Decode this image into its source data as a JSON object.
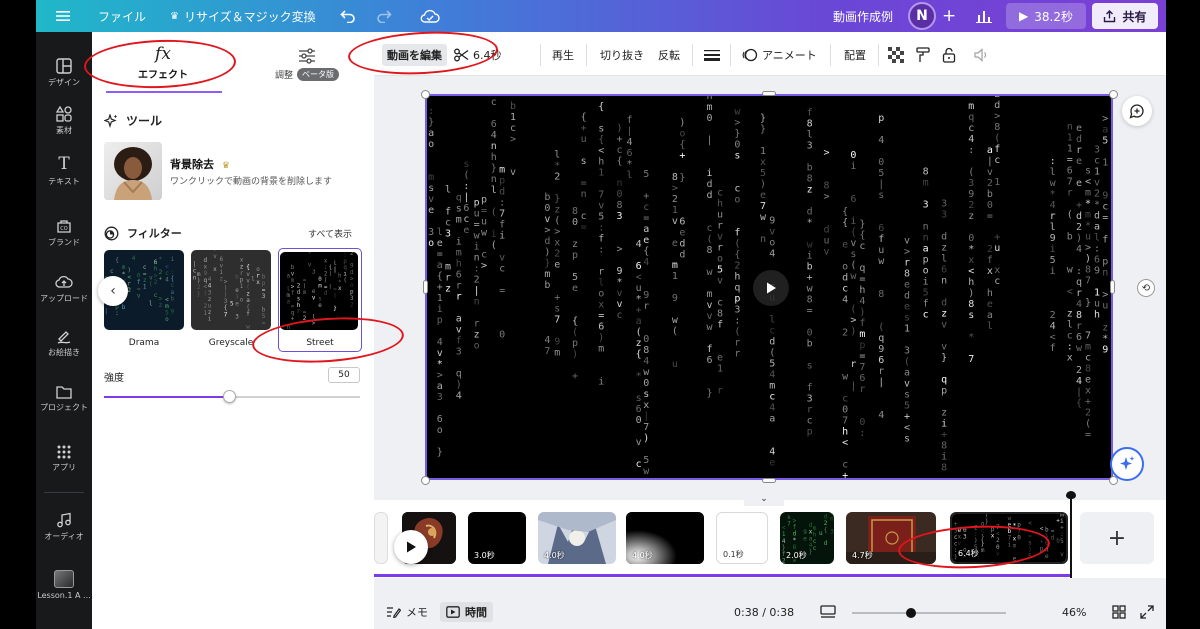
{
  "topbar": {
    "file": "ファイル",
    "resize": "リサイズ＆マジック変換",
    "project_title": "動画作成例",
    "avatar_initial": "N",
    "play_duration": "38.2秒",
    "share": "共有"
  },
  "rail": {
    "items": [
      {
        "label": "デザイン",
        "icon": "layout-icon"
      },
      {
        "label": "素材",
        "icon": "shapes-icon"
      },
      {
        "label": "テキスト",
        "icon": "text-icon"
      },
      {
        "label": "ブランド",
        "icon": "brand-icon"
      },
      {
        "label": "アップロード",
        "icon": "upload-icon"
      },
      {
        "label": "お絵描き",
        "icon": "draw-icon"
      },
      {
        "label": "プロジェクト",
        "icon": "folder-icon"
      },
      {
        "label": "アプリ",
        "icon": "apps-icon"
      },
      {
        "label": "オーディオ",
        "icon": "music-icon"
      },
      {
        "label": "Lesson.1 A ...",
        "icon": "lesson-thumb"
      }
    ]
  },
  "panel": {
    "tab_effects": {
      "icon": "fx",
      "label": "エフェクト"
    },
    "tab_adjust": {
      "label": "調整",
      "badge": "ベータ版"
    },
    "tools_heading": "ツール",
    "bg_remove": {
      "title": "背景除去",
      "description": "ワンクリックで動画の背景を削除します"
    },
    "filters_heading": "フィルター",
    "see_all": "すべて表示",
    "filters": [
      {
        "name": "Drama"
      },
      {
        "name": "Greyscale"
      },
      {
        "name": "Street",
        "selected": true
      }
    ],
    "intensity": {
      "label": "強度",
      "value": 50,
      "max": 100
    }
  },
  "toolbar": {
    "edit_video": "動画を編集",
    "clip_length": "6.4秒",
    "playback": "再生",
    "crop": "切り抜き",
    "flip": "反転",
    "animate": "アニメート",
    "position": "配置"
  },
  "timeline": {
    "clips": [
      {
        "duration": "",
        "theme": "light"
      },
      {
        "duration": "",
        "theme": "art"
      },
      {
        "duration": "3.0秒",
        "theme": "dark"
      },
      {
        "duration": "4.0秒",
        "theme": "anime"
      },
      {
        "duration": "4.0秒",
        "theme": "dark"
      },
      {
        "duration": "0.1秒",
        "theme": "light"
      },
      {
        "duration": "2.0秒",
        "theme": "matrix"
      },
      {
        "duration": "4.7秒",
        "theme": "book"
      },
      {
        "duration": "6.4秒",
        "theme": "street",
        "selected": true
      }
    ]
  },
  "bottombar": {
    "notes": "メモ",
    "timing": "時間",
    "timecode": "0:38 / 0:38",
    "zoom": "46%",
    "zoom_fraction": 0.46
  },
  "colors": {
    "accent": "#7c3aed",
    "annotation": "#e0161c",
    "rail_bg": "#18191b"
  }
}
